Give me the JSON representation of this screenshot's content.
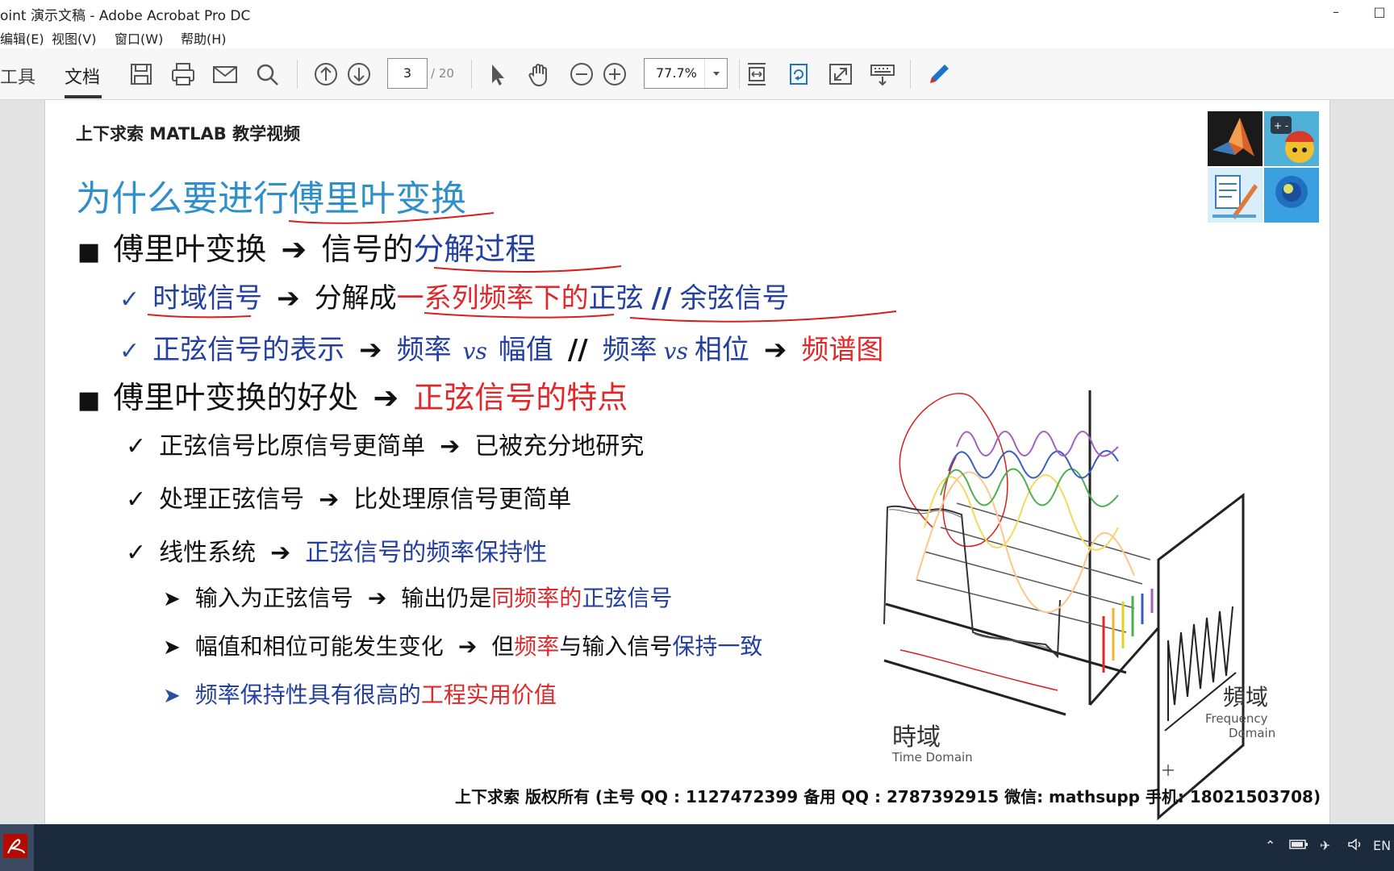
{
  "window": {
    "title": "oint 演示文稿 - Adobe Acrobat Pro DC"
  },
  "menu": {
    "items": [
      "编辑(E)",
      "视图(V)",
      "窗口(W)",
      "帮助(H)"
    ]
  },
  "toolbar": {
    "tab_tools": "工具",
    "tab_document": "文档",
    "page_current": "3",
    "page_total": "/ 20",
    "zoom": "77.7%"
  },
  "slide": {
    "header": "上下求索 MATLAB 教学视频",
    "title": "为什么要进行傅里叶变换",
    "b1": {
      "a": "傅里叶变换",
      "b": "信号的",
      "c": "分解过程"
    },
    "b1_1": {
      "a": "时域信号",
      "b": "分解成",
      "c": "一系列频率下的",
      "d": "正弦",
      "e": "//",
      "f": "余弦信号"
    },
    "b1_2": {
      "a": "正弦信号的表示",
      "b": "频率",
      "c": "vs",
      "d": "幅值",
      "e": "//",
      "f": "频率",
      "g": "vs",
      "h": "相位",
      "i": "频谱图"
    },
    "b2": {
      "a": "傅里叶变换的好处",
      "b": "正弦信号的特点"
    },
    "b2_1": {
      "a": "正弦信号比原信号更简单",
      "b": "已被充分地研究"
    },
    "b2_2": {
      "a": "处理正弦信号",
      "b": "比处理原信号更简单"
    },
    "b2_3": {
      "a": "线性系统",
      "b": "正弦信号的频率保持性"
    },
    "b2_3_1": {
      "a": "输入为正弦信号",
      "b": "输出仍是",
      "c": "同频率的",
      "d": "正弦信号"
    },
    "b2_3_2": {
      "a": "幅值和相位可能发生变化",
      "b": "但",
      "c": "频率",
      "d": "与输入信号",
      "e": "保持一致"
    },
    "b2_3_3": {
      "a": "频率保持性具有很高的",
      "b": "工程实用价值"
    },
    "illus": {
      "time_zh": "時域",
      "time_en": "Time Domain",
      "freq_zh": "頻域",
      "freq_en1": "Frequency",
      "freq_en2": "Domain"
    },
    "footer": "上下求索  版权所有  (主号 QQ : 1127472399   备用 QQ : 2787392915   微信: mathsupp   手机: 18021503708)"
  },
  "taskbar": {
    "lang": "EN"
  },
  "colors": {
    "title_blue": "#2f8fc9",
    "text_blue": "#2340a0",
    "text_red": "#e0272a",
    "annotation_red": "#d81e1e"
  }
}
